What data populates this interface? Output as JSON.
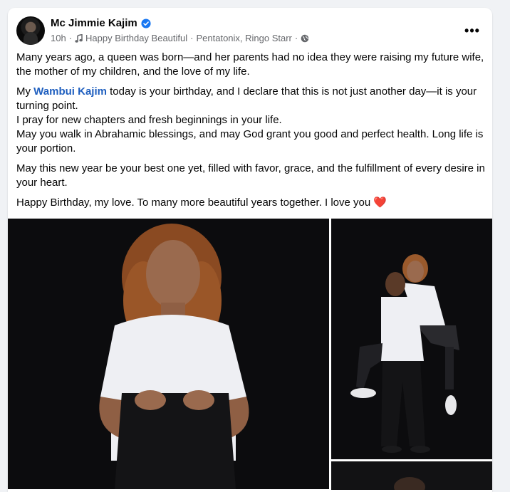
{
  "post": {
    "author_name": "Mc Jimmie Kajim",
    "time": "10h",
    "separator1": "·",
    "song": "Happy Birthday Beautiful",
    "separator2": "·",
    "artists": "Pentatonix, Ringo Starr",
    "separator3": "·",
    "more_label": "•••",
    "icons": {
      "verified": "verified-badge-icon",
      "music": "music-note-icon",
      "privacy": "globe-icon",
      "more": "more-options-icon"
    },
    "colors": {
      "accent": "#1877f2",
      "mention": "#1f5fbf",
      "heart": "#e41e3f",
      "meta": "#65676b"
    },
    "paragraphs": {
      "p1": "Many years ago, a queen was born—and her parents had no idea they were raising my future wife, the mother of my children, and the love of my life.",
      "p2_prefix": "My ",
      "p2_mention": "Wambui Kajim",
      "p2_suffix": " today is your birthday, and I declare that this is not just another day—it is your turning point.",
      "p2_line2": "I pray for new chapters and fresh beginnings in your life.",
      "p2_line3": "May you walk in Abrahamic blessings, and may God grant you good and perfect health. Long life is your portion.",
      "p3": "May this new year be your best one yet, filled with favor, grace, and the fulfillment of every desire in your heart.",
      "p4": "Happy Birthday, my love. To many more beautiful years together. I love you",
      "heart": "❤️"
    }
  }
}
